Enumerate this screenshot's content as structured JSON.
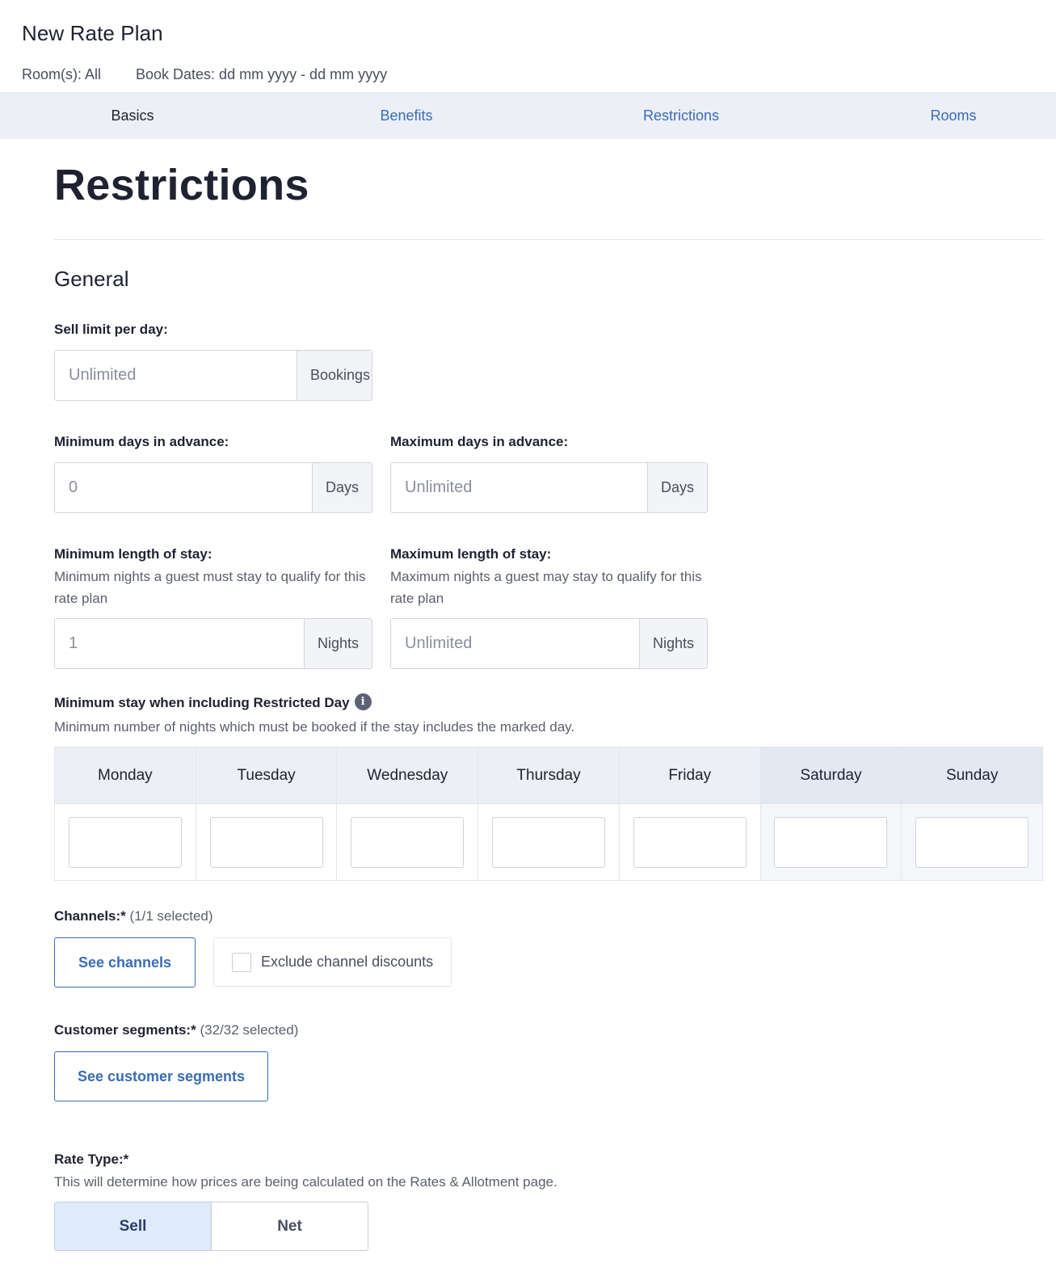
{
  "header": {
    "title": "New Rate Plan",
    "rooms": "Room(s): All",
    "book_dates": "Book Dates: dd mm yyyy - dd mm yyyy"
  },
  "tabs": [
    {
      "label": "Basics",
      "active": true
    },
    {
      "label": "Benefits",
      "active": false
    },
    {
      "label": "Restrictions",
      "active": false
    },
    {
      "label": "Rooms",
      "active": false
    }
  ],
  "page_title": "Restrictions",
  "section_title": "General",
  "sell_limit": {
    "label": "Sell limit per day:",
    "placeholder": "Unlimited",
    "unit": "Bookings"
  },
  "min_days_advance": {
    "label": "Minimum days in advance:",
    "placeholder": "0",
    "unit": "Days"
  },
  "max_days_advance": {
    "label": "Maximum days in advance:",
    "placeholder": "Unlimited",
    "unit": "Days"
  },
  "min_los": {
    "label": "Minimum length of stay:",
    "hint": "Minimum nights a guest must stay to qualify for this rate plan",
    "placeholder": "1",
    "unit": "Nights"
  },
  "max_los": {
    "label": "Maximum length of stay:",
    "hint": "Maximum nights a guest may stay to qualify for this rate plan",
    "placeholder": "Unlimited",
    "unit": "Nights"
  },
  "restricted_day": {
    "label": "Minimum stay when including Restricted Day",
    "info_icon": "info-icon",
    "hint": "Minimum number of nights which must be booked if the stay includes the marked day.",
    "days": [
      "Monday",
      "Tuesday",
      "Wednesday",
      "Thursday",
      "Friday",
      "Saturday",
      "Sunday"
    ],
    "values": [
      "",
      "",
      "",
      "",
      "",
      "",
      ""
    ]
  },
  "channels": {
    "label": "Channels:*",
    "count": "(1/1 selected)",
    "button": "See channels",
    "checkbox_label": "Exclude channel discounts",
    "checkbox_checked": false
  },
  "segments": {
    "label": "Customer segments:*",
    "count": "(32/32 selected)",
    "button": "See customer segments"
  },
  "rate_type": {
    "label": "Rate Type:*",
    "hint": "This will determine how prices are being calculated on the Rates & Allotment page.",
    "options": [
      "Sell",
      "Net"
    ],
    "selected": "Sell"
  },
  "colors": {
    "accent": "#3a6cb8",
    "tabbar_bg": "#eceff5",
    "selected_bg": "#dfeafb"
  }
}
